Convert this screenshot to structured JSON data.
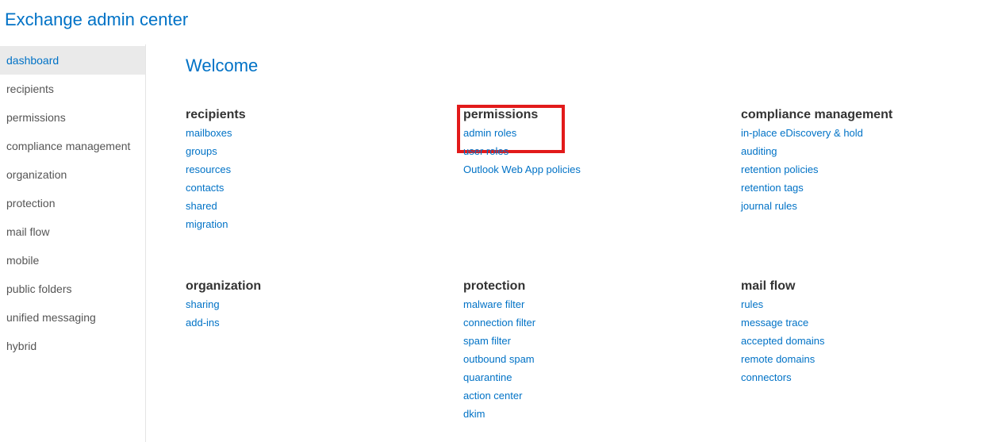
{
  "header": {
    "title": "Exchange admin center"
  },
  "sidebar": {
    "items": [
      {
        "label": "dashboard",
        "active": true
      },
      {
        "label": "recipients",
        "active": false
      },
      {
        "label": "permissions",
        "active": false
      },
      {
        "label": "compliance management",
        "active": false
      },
      {
        "label": "organization",
        "active": false
      },
      {
        "label": "protection",
        "active": false
      },
      {
        "label": "mail flow",
        "active": false
      },
      {
        "label": "mobile",
        "active": false
      },
      {
        "label": "public folders",
        "active": false
      },
      {
        "label": "unified messaging",
        "active": false
      },
      {
        "label": "hybrid",
        "active": false
      }
    ]
  },
  "main": {
    "welcome": "Welcome",
    "cards": [
      {
        "title": "recipients",
        "highlighted": false,
        "links": [
          "mailboxes",
          "groups",
          "resources",
          "contacts",
          "shared",
          "migration"
        ]
      },
      {
        "title": "permissions",
        "highlighted": true,
        "highlighted_links": 1,
        "links": [
          "admin roles",
          "user roles",
          "Outlook Web App policies"
        ]
      },
      {
        "title": "compliance management",
        "highlighted": false,
        "links": [
          "in-place eDiscovery & hold",
          "auditing",
          "retention policies",
          "retention tags",
          "journal rules"
        ]
      },
      {
        "title": "organization",
        "highlighted": false,
        "links": [
          "sharing",
          "add-ins"
        ]
      },
      {
        "title": "protection",
        "highlighted": false,
        "links": [
          "malware filter",
          "connection filter",
          "spam filter",
          "outbound spam",
          "quarantine",
          "action center",
          "dkim"
        ]
      },
      {
        "title": "mail flow",
        "highlighted": false,
        "links": [
          "rules",
          "message trace",
          "accepted domains",
          "remote domains",
          "connectors"
        ]
      }
    ]
  }
}
